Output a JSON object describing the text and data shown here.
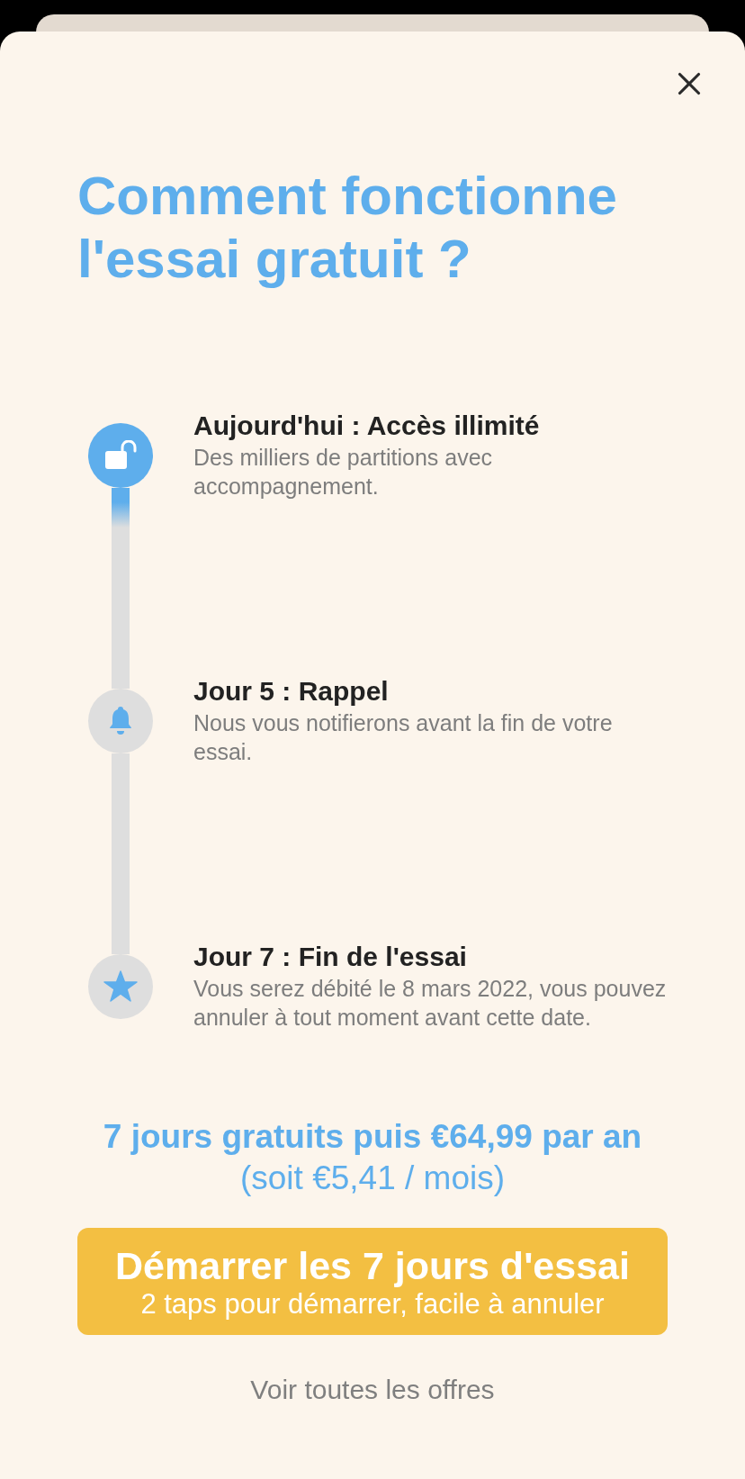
{
  "title": "Comment fonctionne l'essai gratuit ?",
  "steps": [
    {
      "kind": "unlock",
      "active": true,
      "title": "Aujourd'hui : Accès illimité",
      "description": "Des milliers de partitions avec accompagnement."
    },
    {
      "kind": "bell",
      "active": false,
      "title": "Jour 5 : Rappel",
      "description": "Nous vous notifierons avant la fin de votre essai."
    },
    {
      "kind": "star",
      "active": false,
      "title": "Jour 7 : Fin de l'essai",
      "description": "Vous serez débité le 8 mars 2022, vous pouvez annuler à tout moment avant cette date."
    }
  ],
  "price": "7 jours gratuits puis €64,99 par an",
  "price_note": "(soit €5,41 / mois)",
  "cta": {
    "label": "Démarrer les 7 jours d'essai",
    "sublabel": "2 taps pour démarrer, facile à annuler"
  },
  "link": "Voir toutes les offres"
}
